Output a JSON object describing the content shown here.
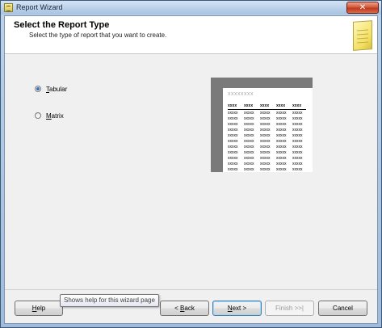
{
  "window": {
    "title": "Report Wizard",
    "close_label": "✕"
  },
  "header": {
    "title": "Select the Report Type",
    "subtitle": "Select the type of report that you want to create."
  },
  "options": {
    "tabular": {
      "prefix": "",
      "accel": "T",
      "rest": "abular",
      "checked": true
    },
    "matrix": {
      "prefix": "",
      "accel": "M",
      "rest": "atrix",
      "checked": false
    }
  },
  "preview": {
    "title": "xxxxxxxx",
    "header_cells": [
      "xxxx",
      "xxxx",
      "xxxx",
      "xxxx",
      "xxxx"
    ],
    "cell_text": "xxxxx",
    "row_count": 11
  },
  "buttons": {
    "help": {
      "accel": "H",
      "rest": "elp"
    },
    "back": {
      "pre": "< ",
      "accel": "B",
      "rest": "ack"
    },
    "next": {
      "accel": "N",
      "rest": "ext >"
    },
    "finish": "Finish >>|",
    "cancel": "Cancel"
  },
  "tooltip": "Shows help for this wizard page"
}
